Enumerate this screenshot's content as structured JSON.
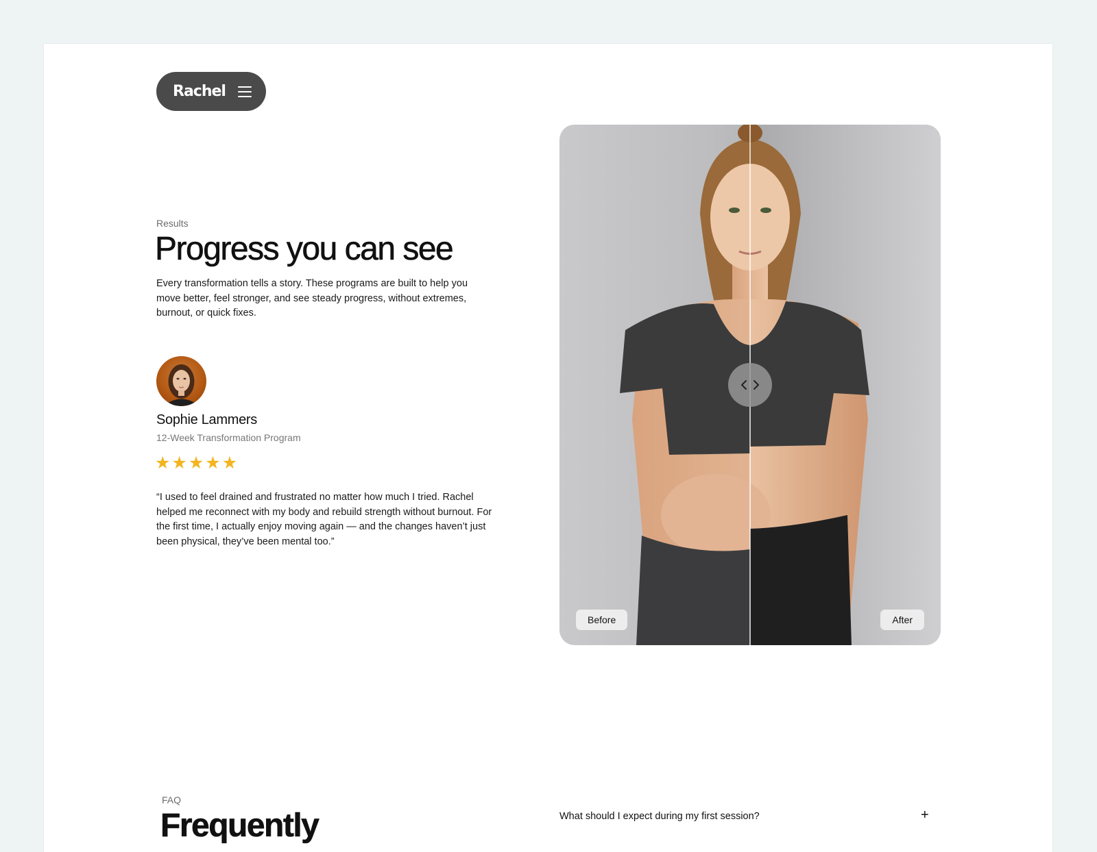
{
  "nav": {
    "logo": "Rachel",
    "menu_icon": "hamburger-menu-icon"
  },
  "results": {
    "eyebrow": "Results",
    "title": "Progress you can see",
    "description": "Every transformation tells a story. These programs are built to help you move better, feel stronger, and see steady progress, without extremes, burnout, or quick fixes."
  },
  "testimonial": {
    "name": "Sophie Lammers",
    "program": "12-Week Transformation Program",
    "rating": 5,
    "stars": [
      "★",
      "★",
      "★",
      "★",
      "★"
    ],
    "star_color": "#f2b51f",
    "quote": "“I used to feel drained and frustrated no matter how much I tried. Rachel helped me reconnect with my body and rebuild strength without burnout. For the first time, I actually enjoy moving again — and the changes haven’t just been physical, they’ve been mental too.”"
  },
  "comparison": {
    "before_label": "Before",
    "after_label": "After",
    "slider_position": 0.5,
    "handle_icon": "chevron-left-right-icon"
  },
  "faq": {
    "eyebrow": "FAQ",
    "title": "Frequently",
    "first_question": "What should I expect during my first session?",
    "expand_icon": "+"
  }
}
